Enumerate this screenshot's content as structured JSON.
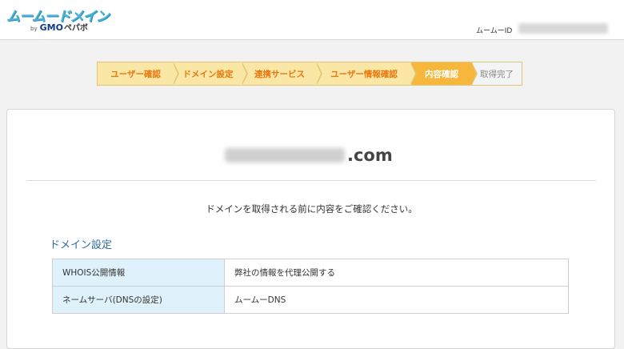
{
  "header": {
    "logo_main": "ムームードメイン",
    "logo_by": "by",
    "logo_gmo": "GMO",
    "logo_pepabo": "ペパボ",
    "muu_id_label": "ムームーID"
  },
  "steps": [
    {
      "label": "ユーザー確認",
      "state": "done"
    },
    {
      "label": "ドメイン設定",
      "state": "done"
    },
    {
      "label": "連携サービス",
      "state": "done"
    },
    {
      "label": "ユーザー情報確認",
      "state": "done"
    },
    {
      "label": "内容確認",
      "state": "current"
    },
    {
      "label": "取得完了",
      "state": "todo"
    }
  ],
  "domain": {
    "tld": ".com"
  },
  "confirm_message": "ドメインを取得される前に内容をご確認ください。",
  "section": {
    "title": "ドメイン設定"
  },
  "settings": [
    {
      "label": "WHOIS公開情報",
      "value": "弊社の情報を代理公開する"
    },
    {
      "label": "ネームサーバ(DNSの設定)",
      "value": "ムームーDNS"
    }
  ],
  "colors": {
    "accent_orange": "#e8780e",
    "current_step": "#f6b73c",
    "step_bg": "#fbe7a5",
    "section_title": "#2f6ea3",
    "table_label_bg": "#dff2fb"
  }
}
